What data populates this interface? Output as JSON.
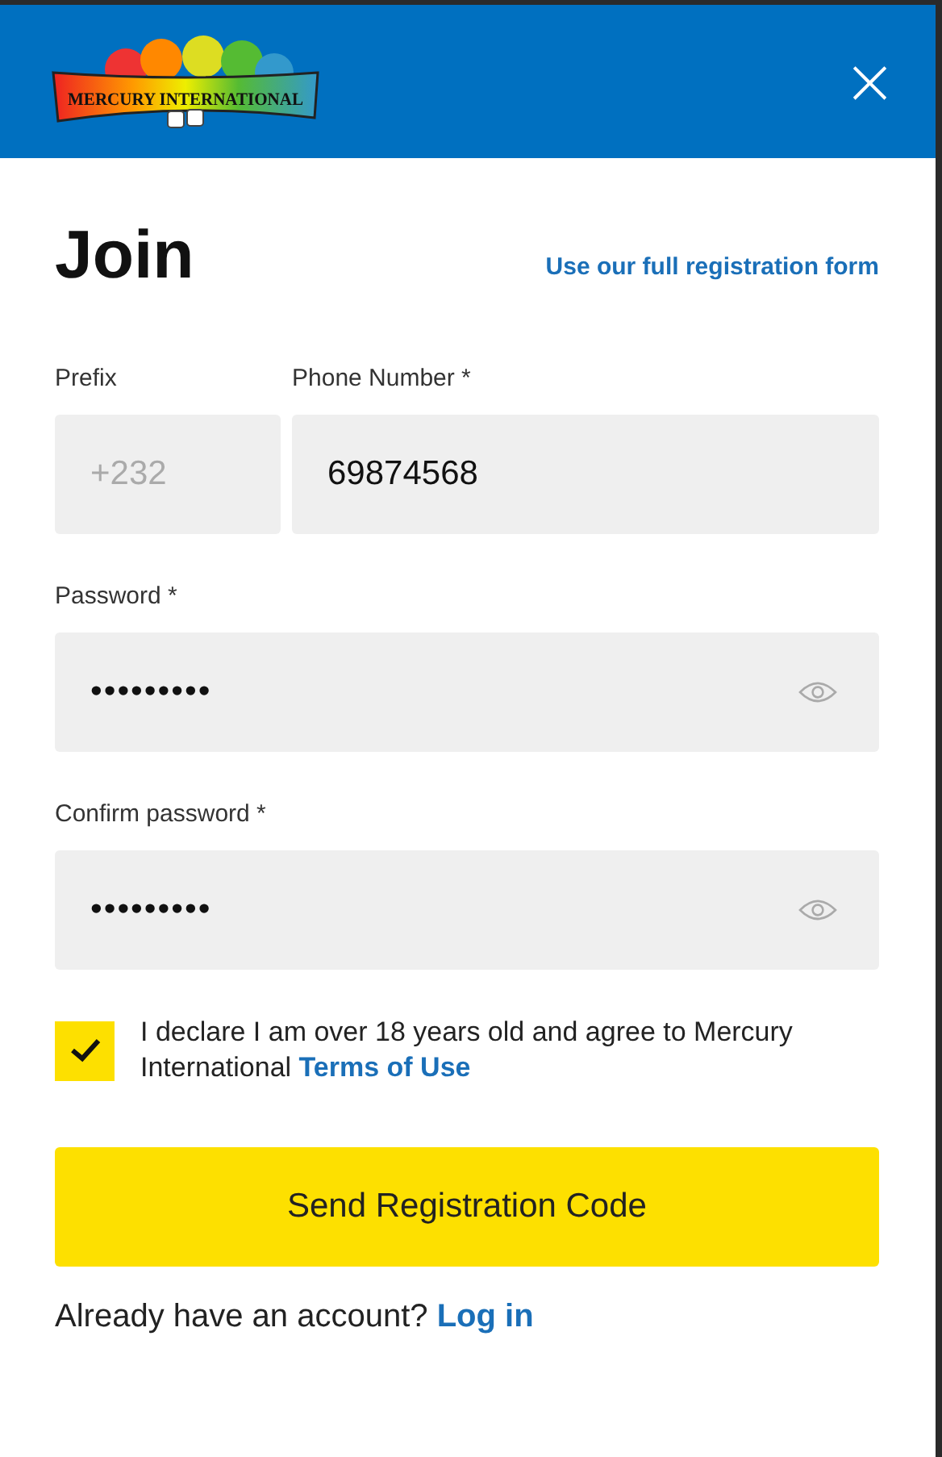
{
  "header": {
    "logo_text": "MERCURY INTERNATIONAL",
    "close": "×"
  },
  "title": "Join",
  "full_form_link": "Use our full registration form",
  "prefix": {
    "label": "Prefix",
    "placeholder": "+232",
    "disabled": true
  },
  "phone": {
    "label": "Phone Number *",
    "value": "69874568"
  },
  "passwords": [
    {
      "label": "Password *",
      "value": "•••••••••"
    },
    {
      "label": "Confirm password *",
      "value": "•••••••••"
    }
  ],
  "consent": {
    "checked": true,
    "text": "I declare I am over 18 years old and agree to Mercury International",
    "link": "Terms of Use"
  },
  "submit": "Send Registration Code",
  "login": {
    "text": "Already have an account?",
    "link": "Log in"
  }
}
